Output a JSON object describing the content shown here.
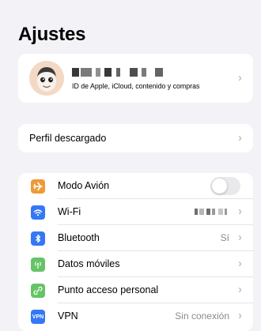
{
  "header": {
    "title": "Ajustes"
  },
  "profile": {
    "subtitle": "ID de Apple, iCloud, contenido y compras",
    "avatar_icon": "memoji-avatar-icon"
  },
  "downloaded_profile": {
    "label": "Perfil descargado"
  },
  "settings": {
    "airplane": {
      "label": "Modo Avión",
      "icon": "airplane-icon",
      "color": "#f09a37",
      "on": false
    },
    "wifi": {
      "label": "Wi-Fi",
      "icon": "wifi-icon",
      "color": "#3478f6"
    },
    "bluetooth": {
      "label": "Bluetooth",
      "value": "Sí",
      "icon": "bluetooth-icon",
      "color": "#3478f6"
    },
    "cellular": {
      "label": "Datos móviles",
      "icon": "antenna-icon",
      "color": "#65c466"
    },
    "hotspot": {
      "label": "Punto acceso personal",
      "icon": "hotspot-icon",
      "color": "#65c466"
    },
    "vpn": {
      "label": "VPN",
      "value": "Sin conexión",
      "icon": "vpn-icon",
      "color": "#3478f6"
    }
  },
  "colors": {
    "background": "#f2f2f7",
    "chevron": "#c4c4c9",
    "secondary_text": "#8a8a8e"
  }
}
